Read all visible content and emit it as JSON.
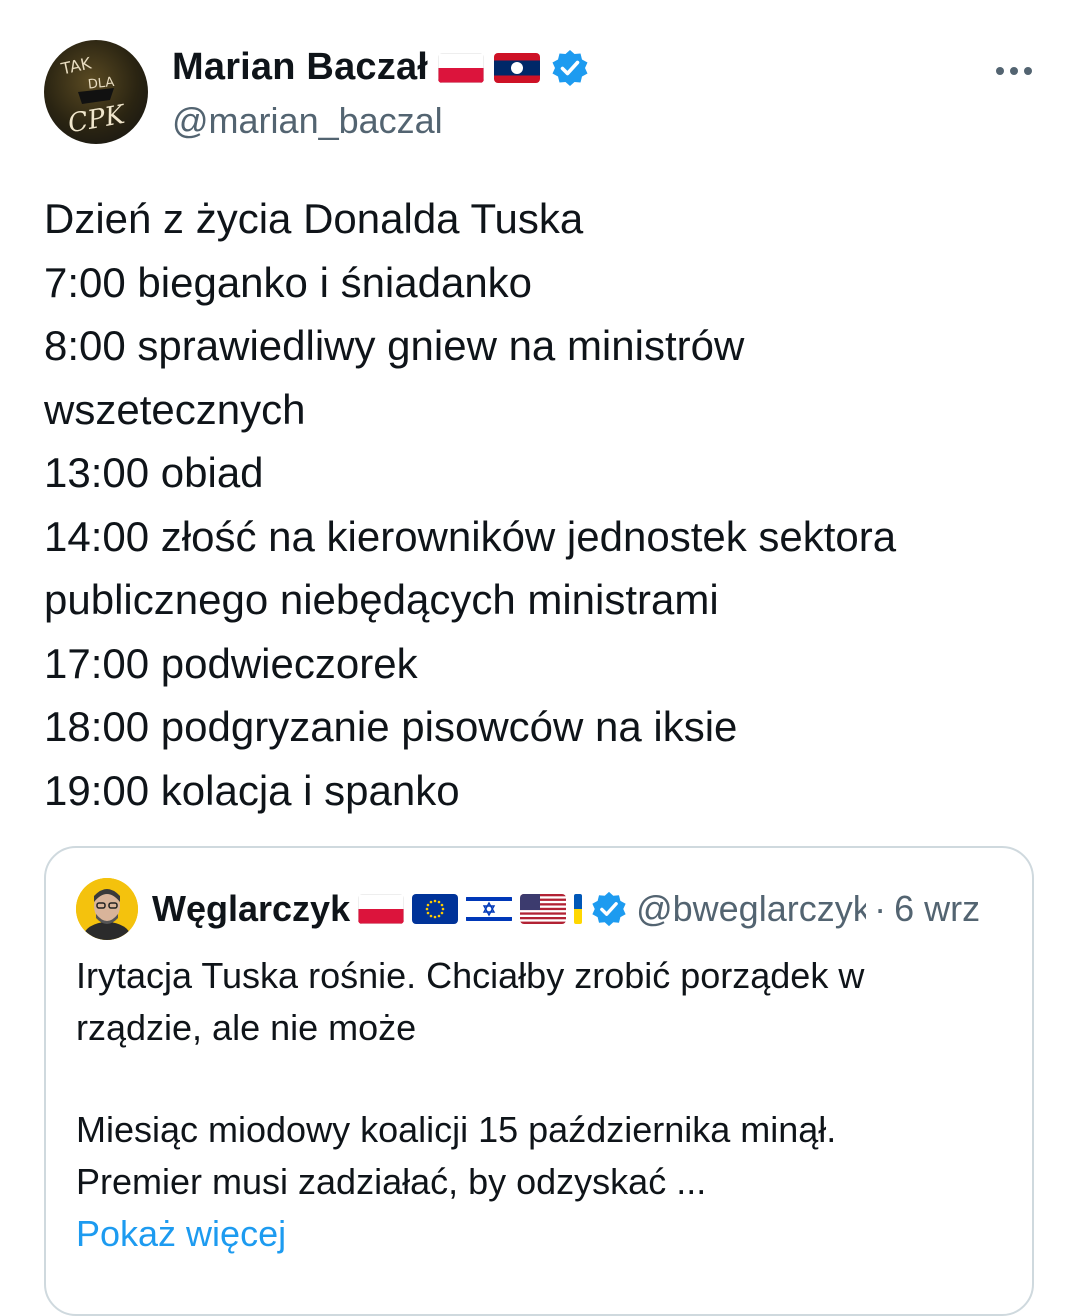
{
  "author": {
    "display_name": "Marian Baczał",
    "handle": "@marian_baczal",
    "avatar_text": "TAK DLA CPK",
    "flags": [
      "poland-flag-icon",
      "laos-flag-icon"
    ],
    "verified_icon": "verified-badge-icon"
  },
  "more_icon": "more-horizontal-icon",
  "tweet_lines": [
    "Dzień z życia Donalda Tuska",
    "7:00 bieganko i śniadanko",
    "8:00 sprawiedliwy gniew na ministrów",
    "wszetecznych",
    "13:00 obiad",
    "14:00 złość na kierowników jednostek sektora",
    "publicznego niebędących ministrami",
    "17:00 podwieczorek",
    "18:00 podgryzanie pisowców na iksie",
    "19:00 kolacja i spanko"
  ],
  "quote": {
    "display_name": "Węglarczyk",
    "handle": "@bweglarczyk",
    "separator": "·",
    "date": "6 wrz",
    "flags": [
      "poland-flag-icon",
      "eu-flag-icon",
      "israel-flag-icon",
      "usa-flag-icon",
      "ukraine-flag-icon"
    ],
    "paragraph1_lines": [
      "Irytacja Tuska rośnie. Chciałby zrobić porządek w",
      "rządzie, ale nie może"
    ],
    "paragraph2_lines": [
      "Miesiąc miodowy koalicji 15 października minął.",
      "Premier musi zadziałać, by odzyskać ..."
    ],
    "show_more": "Pokaż więcej"
  },
  "colors": {
    "text": "#0f1419",
    "secondary": "#536471",
    "link": "#1d9bf0",
    "border": "#cfd9de",
    "verified": "#1d9bf0"
  }
}
